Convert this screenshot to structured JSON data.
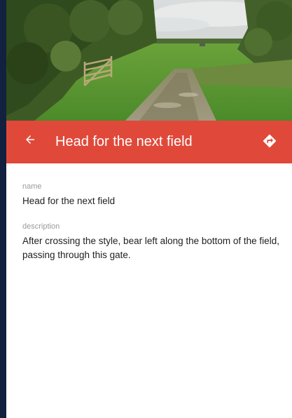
{
  "photo": {
    "alt_icon": "field-path-photo"
  },
  "appbar": {
    "back_icon": "arrow-left-icon",
    "title": "Head for the next field",
    "directions_icon": "directions-icon",
    "color": "#e0493a"
  },
  "details": {
    "name_label": "name",
    "name_value": "Head for the next field",
    "description_label": "description",
    "description_value": "After crossing the style, bear left along the bottom of the field, passing through this gate."
  },
  "colors": {
    "sidebar": "#12213f",
    "accent": "#e0493a"
  }
}
